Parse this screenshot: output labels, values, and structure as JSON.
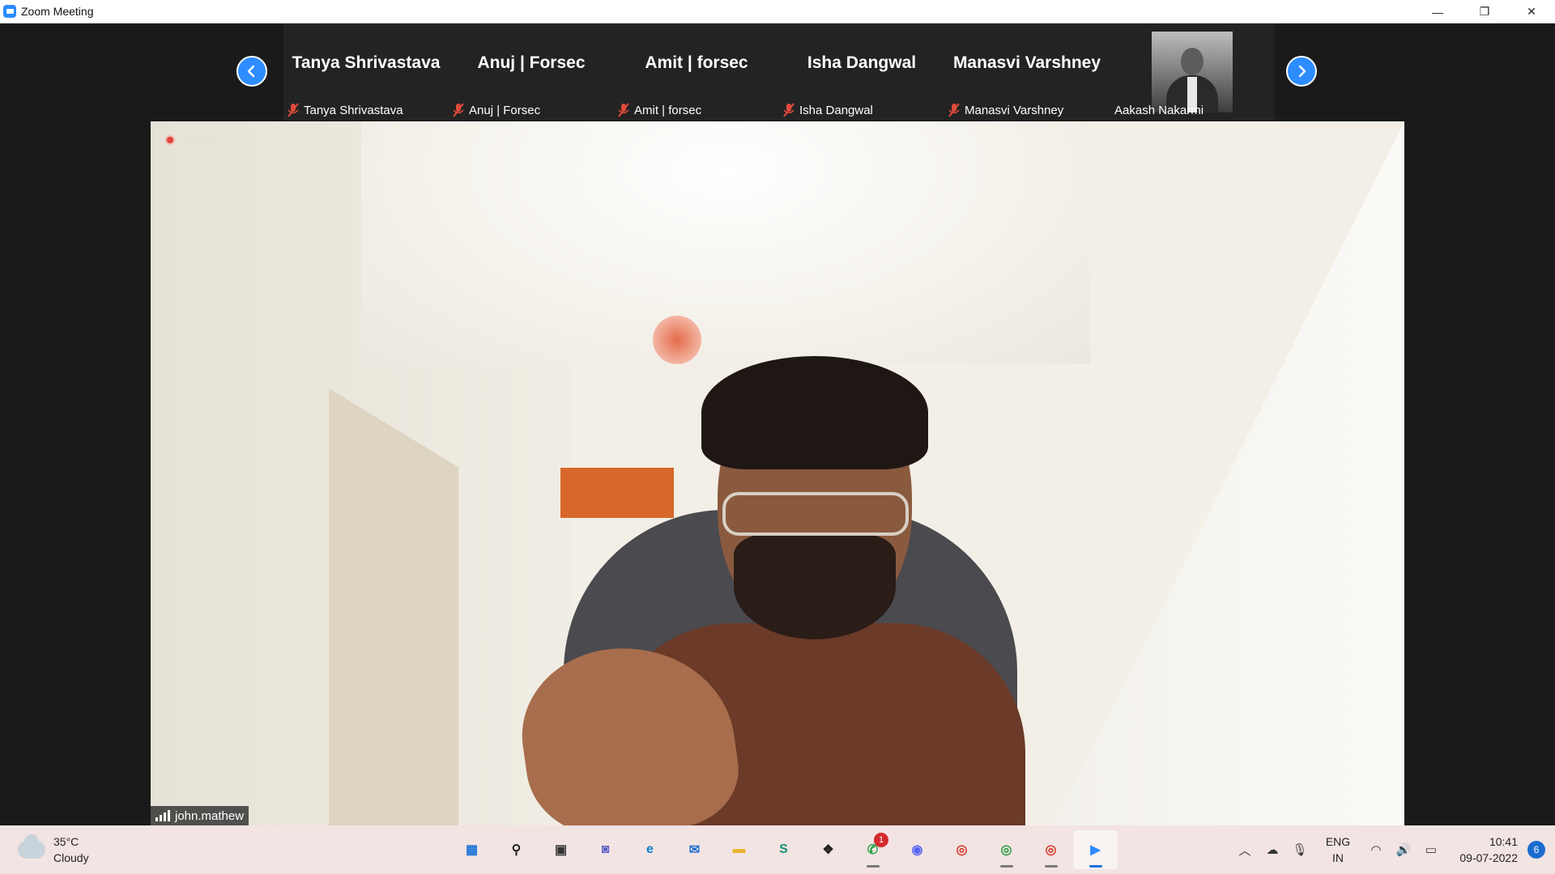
{
  "window": {
    "title": "Zoom Meeting",
    "minimize_glyph": "—",
    "restore_glyph": "❐",
    "close_glyph": "✕"
  },
  "participants_strip": {
    "tiles": [
      {
        "display_name": "Tanya Shrivastava",
        "label": "Tanya Shrivastava",
        "muted": true,
        "has_photo": false
      },
      {
        "display_name": "Anuj | Forsec",
        "label": "Anuj | Forsec",
        "muted": true,
        "has_photo": false
      },
      {
        "display_name": "Amit | forsec",
        "label": "Amit | forsec",
        "muted": true,
        "has_photo": false
      },
      {
        "display_name": "Isha Dangwal",
        "label": "Isha Dangwal",
        "muted": true,
        "has_photo": false
      },
      {
        "display_name": "Manasvi Varshney",
        "label": "Manasvi Varshney",
        "muted": true,
        "has_photo": false
      },
      {
        "display_name": "",
        "label": "Aakash Nakarmi",
        "muted": false,
        "has_photo": true
      }
    ]
  },
  "active_speaker": {
    "name": "john.mathew",
    "recording_label": "Recording"
  },
  "taskbar": {
    "weather": {
      "temp": "35°C",
      "condition": "Cloudy"
    },
    "apps": [
      {
        "name": "start",
        "glyph": "▦",
        "color": "#1e74d8"
      },
      {
        "name": "search",
        "glyph": "⚲",
        "color": "#222222"
      },
      {
        "name": "task-view",
        "glyph": "▣",
        "color": "#333333"
      },
      {
        "name": "teams-chat",
        "glyph": "◙",
        "color": "#5b5fc7"
      },
      {
        "name": "edge",
        "glyph": "e",
        "color": "#0c7bd3"
      },
      {
        "name": "mail",
        "glyph": "✉",
        "color": "#1a6ccf"
      },
      {
        "name": "file-explorer",
        "glyph": "▬",
        "color": "#e8b52c"
      },
      {
        "name": "app-s",
        "glyph": "S",
        "color": "#1c8d76"
      },
      {
        "name": "dropbox",
        "glyph": "❖",
        "color": "#222222"
      },
      {
        "name": "whatsapp",
        "glyph": "✆",
        "color": "#25a244",
        "badge": "1"
      },
      {
        "name": "discord",
        "glyph": "◉",
        "color": "#5865f2"
      },
      {
        "name": "chrome",
        "glyph": "◎",
        "color": "#d93b2f"
      },
      {
        "name": "chrome-profile-2",
        "glyph": "◎",
        "color": "#2f9e44"
      },
      {
        "name": "chrome-profile-m",
        "glyph": "◎",
        "color": "#d93b2f"
      },
      {
        "name": "zoom",
        "glyph": "▶",
        "color": "#2d8cff",
        "active": true
      }
    ],
    "tray": {
      "lang_line1": "ENG",
      "lang_line2": "IN",
      "time": "10:41",
      "date": "09-07-2022",
      "notifications": "6"
    }
  }
}
